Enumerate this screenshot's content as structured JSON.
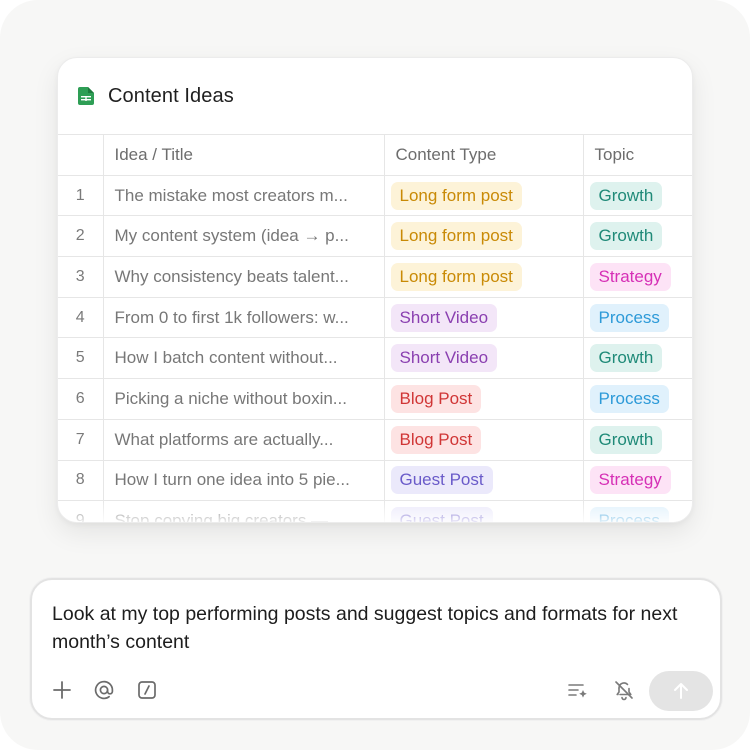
{
  "sheet": {
    "title": "Content Ideas",
    "columns": [
      "",
      "Idea / Title",
      "Content Type",
      "Topic"
    ],
    "rows": [
      {
        "num": "1",
        "idea": "The mistake most creators m...",
        "type": "Long form post",
        "topic": "Growth"
      },
      {
        "num": "2",
        "idea": "My content system (idea → p...",
        "type": "Long form post",
        "topic": "Growth"
      },
      {
        "num": "3",
        "idea": "Why consistency beats talent...",
        "type": "Long form post",
        "topic": "Strategy"
      },
      {
        "num": "4",
        "idea": "From 0 to first 1k followers: w...",
        "type": "Short Video",
        "topic": "Process"
      },
      {
        "num": "5",
        "idea": "How I batch content without...",
        "type": "Short Video",
        "topic": "Growth"
      },
      {
        "num": "6",
        "idea": "Picking a niche without boxin...",
        "type": "Blog Post",
        "topic": "Process"
      },
      {
        "num": "7",
        "idea": "What platforms are actually...",
        "type": "Blog Post",
        "topic": "Growth"
      },
      {
        "num": "8",
        "idea": "How I turn one idea into 5 pie...",
        "type": "Guest Post",
        "topic": "Strategy"
      },
      {
        "num": "9",
        "idea": "Stop copying big creators —",
        "type": "Guest Post",
        "topic": "Process"
      }
    ],
    "type_colors": {
      "Long form post": {
        "bg": "#fdf3d8",
        "fg": "#c98a06"
      },
      "Short Video": {
        "bg": "#f3e6f8",
        "fg": "#8a3fb0"
      },
      "Blog Post": {
        "bg": "#fde3e3",
        "fg": "#d03636"
      },
      "Guest Post": {
        "bg": "#ebe9fb",
        "fg": "#6a5bc9"
      }
    },
    "topic_colors": {
      "Growth": {
        "bg": "#def2ee",
        "fg": "#1f8a78"
      },
      "Strategy": {
        "bg": "#fde3f6",
        "fg": "#d630b6"
      },
      "Process": {
        "bg": "#e0f1fc",
        "fg": "#2d9ad8"
      }
    },
    "icon": "spreadsheet-icon",
    "icon_color": "#2e9e55"
  },
  "prompt": {
    "text": "Look at my top performing posts and suggest topics and formats for next month’s content",
    "tools": [
      "plus-icon",
      "at-mention-icon",
      "slash-command-icon",
      "list-sparkle-icon",
      "bell-off-icon"
    ],
    "send_icon": "arrow-up-icon"
  }
}
